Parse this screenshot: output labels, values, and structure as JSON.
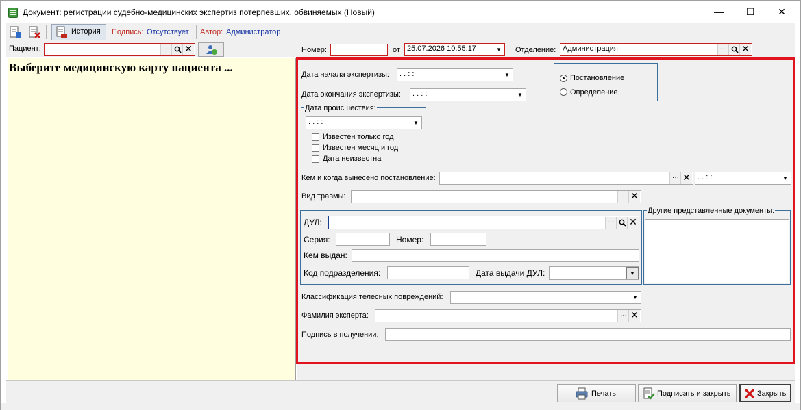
{
  "window": {
    "title": "Документ: регистрации судебно-медицинских экспертиз потерпевших, обвиняемых (Новый)",
    "minimize_glyph": "—",
    "maximize_glyph": "☐",
    "close_glyph": "✕"
  },
  "toolbar": {
    "history_label": "История",
    "signature_label": "Подпись:",
    "signature_value": "Отсутствует",
    "author_label": "Автор:",
    "author_value": "Администратор"
  },
  "header": {
    "patient_label": "Пациент:",
    "patient_value": "",
    "number_label": "Номер:",
    "number_value": "",
    "from_label": "от",
    "date_value": "25.07.2026 10:55:17",
    "department_label": "Отделение:",
    "department_value": "Администрация"
  },
  "left_panel": {
    "message": "Выберите медицинскую карту пациента ..."
  },
  "form": {
    "start_date_label": "Дата начала экспертизы:",
    "start_date_value": ". .     : :",
    "end_date_label": "Дата окончания экспертизы:",
    "end_date_value": ". .     : :",
    "incident_group_title": "Дата происшествия:",
    "incident_date_value": ". .     : :",
    "only_year_label": "Известен только год",
    "month_year_label": "Известен месяц и год",
    "date_unknown_label": "Дата неизвестна",
    "doc_type_options": [
      "Постановление",
      "Определение"
    ],
    "doc_type_selected": "Постановление",
    "issued_by_label": "Кем и когда вынесено постановление:",
    "issued_by_value": "",
    "issued_date_value": ". .     : :",
    "injury_type_label": "Вид травмы:",
    "injury_type_value": "",
    "dul_label": "ДУЛ:",
    "dul_value": "",
    "series_label": "Серия:",
    "series_value": "",
    "number_label": "Номер:",
    "number_value": "",
    "issued_by_dul_label": "Кем выдан:",
    "issued_by_dul_value": "",
    "division_code_label": "Код подразделения:",
    "division_code_value": "",
    "dul_issue_date_label": "Дата выдачи ДУЛ:",
    "dul_issue_date_value": "",
    "other_docs_title": "Другие представленные документы:",
    "injury_class_label": "Классификация телесных повреждений:",
    "injury_class_value": "",
    "expert_label": "Фамилия эксперта:",
    "expert_value": "",
    "receipt_sign_label": "Подпись в получении:",
    "receipt_sign_value": ""
  },
  "buttons": {
    "print_label": "Печать",
    "sign_close_label": "Подписать и закрыть",
    "close_label": "Закрыть"
  },
  "glyphs": {
    "ellipsis": "···",
    "search": "⚲",
    "clear": "✕",
    "dropdown": "▼"
  }
}
